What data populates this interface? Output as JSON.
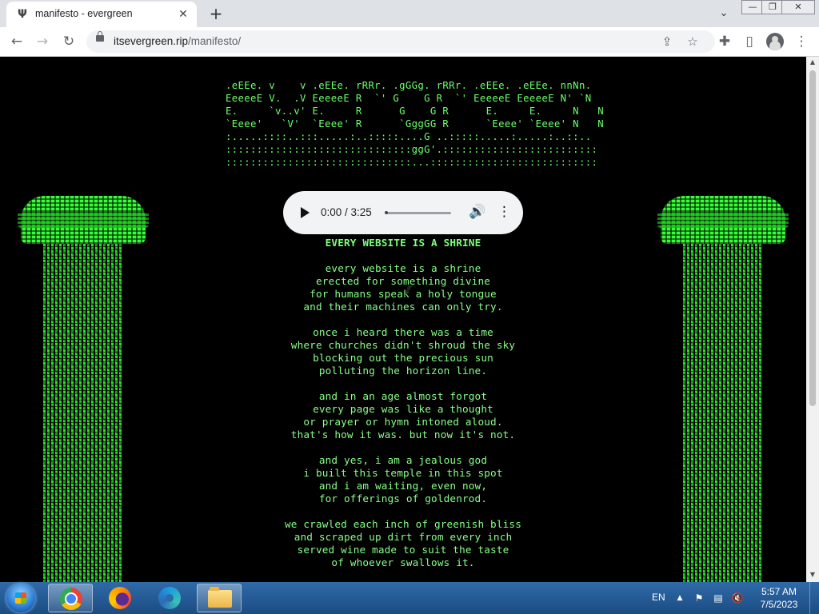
{
  "browser": {
    "tab_title": "manifesto - evergreen",
    "favicon_glyph": "Ψ",
    "tab_close_glyph": "✕",
    "newtab_glyph": "+",
    "url_host": "itsevergreen.rip",
    "url_path": "/manifesto/",
    "window_controls": {
      "minimize": "—",
      "restore": "❐",
      "close": "✕"
    },
    "icons": {
      "back": "←",
      "forward": "→",
      "reload": "↻",
      "share": "⇪",
      "star": "☆",
      "extensions": "✚",
      "sidepanel": "▯",
      "menu": "⋮",
      "tabsearch": "⌄"
    }
  },
  "page": {
    "ascii_art": ".eEEe. v    v .eEEe. rRRr. .gGGg. rRRr. .eEEe. .eEEe. nnNn.\nEeeeeE V.  .V EeeeeE R  `' G    G R  `' EeeeeE EeeeeE N' `N\nE.     `v..v' E.     R      G    G R      E.     E.     N   N\n`Eeee'   `V'  `Eeee' R      `GggGG R      `Eeee' `Eeee' N   N\n:.....::::..:::.....:..:::::....G ..:::::.....:.....:..::..\n::::::::::::::::::::::::::::::ggG'.:::::::::::::::::::::::::\n::::::::::::::::::::::::::::::...:::::::::::::::::::::::::::",
    "audio": {
      "time": "0:00 / 3:25",
      "progress": 0.0,
      "volume_icon": "🔊",
      "more_icon": "⋮"
    },
    "poem_title": "EVERY WEBSITE IS A SHRINE",
    "stanzas": [
      [
        "every website is a shrine",
        "erected for something divine",
        "for humans speak a holy tongue",
        "and their machines can only try."
      ],
      [
        "once i heard there was a time",
        "where churches didn't shroud the sky",
        "blocking out the precious sun",
        "polluting the horizon line."
      ],
      [
        "and in an age almost forgot",
        "every page was like a thought",
        "or prayer or hymn intoned aloud.",
        "that's how it was. but now it's not."
      ],
      [
        "and yes, i am a jealous god",
        "i built this temple in this spot",
        "and i am waiting, even now,",
        "for offerings of goldenrod."
      ],
      [
        "we crawled each inch of greenish bliss",
        "and scraped up dirt from every inch",
        "served wine made to suit the taste",
        "of whoever swallows it."
      ]
    ],
    "colors": {
      "text": "#88ff88",
      "ascii": "#6dff6d",
      "background": "#000000"
    }
  },
  "taskbar": {
    "language": "EN",
    "time": "5:57 AM",
    "date": "7/5/2023",
    "tray_icons": {
      "show_hidden": "▲",
      "flag": "⚑",
      "network": "▤",
      "volume_muted": "🔇"
    }
  }
}
